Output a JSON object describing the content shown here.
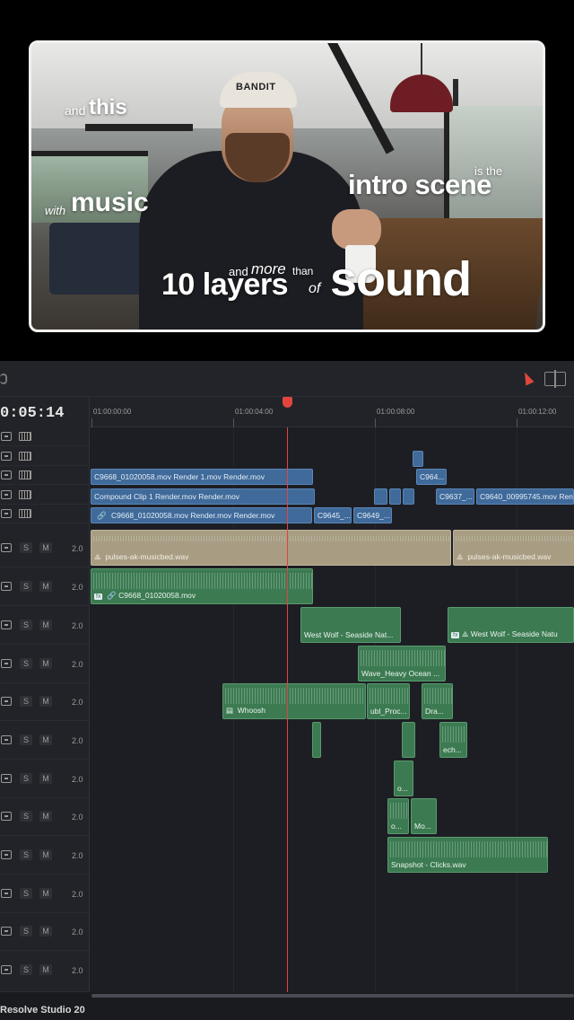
{
  "preview": {
    "cap_brand": "BANDIT",
    "captions": {
      "and": "and",
      "this": "this",
      "with": "with",
      "music": "music",
      "intro_scene": "intro scene",
      "is_the": "is the",
      "and_2": "and",
      "more": "more",
      "than": "than",
      "ten_layers": "10 layers",
      "of": "of",
      "sound": "sound"
    }
  },
  "timeline": {
    "timecode": "0:05:14",
    "ruler_labels": [
      "01:00:00:00",
      "01:00:04:00",
      "01:00:08:00",
      "01:00:12:00"
    ],
    "audio_track_controls": {
      "solo": "S",
      "mute": "M",
      "volume": "2.0"
    },
    "video_clips": {
      "v3_c1": "C9668_01020058.mov Render 1.mov Render.mov",
      "v3_c2": "C964...",
      "v2_c1": "Compound Clip 1 Render.mov Render.mov",
      "v2_c2": "C9637_...",
      "v2_c3": "C9640_00995745.mov Ren",
      "v1_c1": "C9668_01020058.mov Render.mov Render.mov",
      "v1_c2": "C9645_...",
      "v1_c3": "C9649_..."
    },
    "audio_clips": {
      "a1_c1": "pulses-ak-musicbed.wav",
      "a1_c2": "pulses-ak-musicbed.wav",
      "a2_c1": "C9668_01020058.mov",
      "a3_c1": "West Wolf - Seaside Nat...",
      "a3_c2": "West Wolf - Seaside Natu",
      "a4_c1": "Wave_Heavy Ocean ...",
      "a5_c1": "Whoosh",
      "a5_c2": "ubl_Proc...",
      "a5_c3": "Dra...",
      "a6_c1": "ech...",
      "a7_c1": "o...",
      "a8_c1": "o...",
      "a8_c2": "Mo...",
      "a9_c1": "Snapshot - Clicks.wav"
    },
    "colors": {
      "video_clip": "#3f6a9a",
      "audio_clip": "#3c7a52",
      "music_clip": "#a89c83",
      "playhead": "#e0463e"
    }
  },
  "status": {
    "app_name": "Resolve Studio 20"
  }
}
